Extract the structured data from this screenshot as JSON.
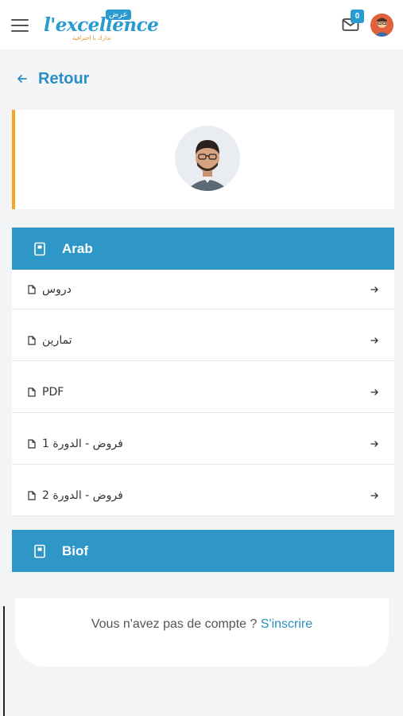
{
  "header": {
    "logo_text": "l'excellence",
    "logo_badge": "عرض",
    "logo_tagline": "تدارك با احترافية",
    "notification_count": "0"
  },
  "back": {
    "label": "Retour"
  },
  "sections": [
    {
      "title": "Arab",
      "items": [
        {
          "label": "دروس"
        },
        {
          "label": "تمارين"
        },
        {
          "label": "PDF"
        },
        {
          "label": "فروض - الدورة 1"
        },
        {
          "label": "فروض - الدورة 2"
        }
      ]
    },
    {
      "title": "Biof"
    }
  ],
  "signup": {
    "prompt": "Vous n'avez pas de compte ?",
    "link": "S'inscrire"
  },
  "colors": {
    "primary": "#2e97c7",
    "accent": "#f5a623"
  },
  "icons": [
    "menu-icon",
    "mail-icon",
    "arrow-left-icon",
    "notebook-icon",
    "file-icon",
    "arrow-right-icon"
  ]
}
